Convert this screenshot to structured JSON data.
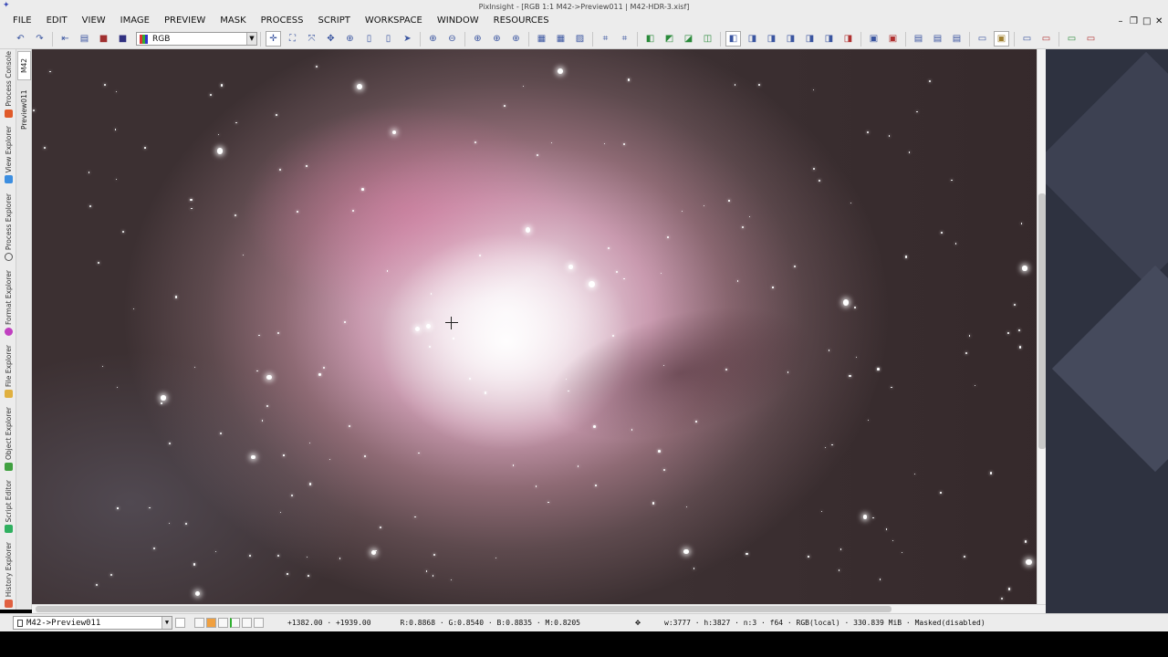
{
  "window": {
    "title": "PixInsight - [RGB 1:1 M42->Preview011 | M42-HDR-3.xisf]",
    "app_icon": "pixinsight-logo-icon",
    "controls": [
      "minimize-icon",
      "restore-icon",
      "maximize-icon",
      "close-icon"
    ]
  },
  "menu": {
    "items": [
      "FILE",
      "EDIT",
      "VIEW",
      "IMAGE",
      "PREVIEW",
      "MASK",
      "PROCESS",
      "SCRIPT",
      "WORKSPACE",
      "WINDOW",
      "RESOURCES"
    ]
  },
  "toolbar": {
    "channel_select": "RGB"
  },
  "sidebar": {
    "tabs": [
      "Process Console",
      "View Explorer",
      "Process Explorer",
      "Format Explorer",
      "File Explorer",
      "Object Explorer",
      "Script Editor",
      "History Explorer"
    ],
    "icon_colors": [
      "#e05a2a",
      "#3c8ee0",
      "#555555",
      "#c040c0",
      "#e0b040",
      "#40a040",
      "#30b060",
      "#e06040"
    ]
  },
  "view_tabs": {
    "items": [
      "M42",
      "Preview011"
    ]
  },
  "status": {
    "view_select": "M42->Preview011",
    "x_coord": "+1382.00",
    "y_coord": "+1939.00",
    "pixel_values": "R:0.8868 · G:0.8540 · B:0.8835 · M:0.8205",
    "image_info": "w:3777 · h:3827 · n:3 · f64 · RGB(local) · 330.839 MiB · Masked(disabled)"
  },
  "colors": {
    "chrome": "#ececec",
    "accent": "#3a55a0",
    "desktop": "#2e3240"
  }
}
